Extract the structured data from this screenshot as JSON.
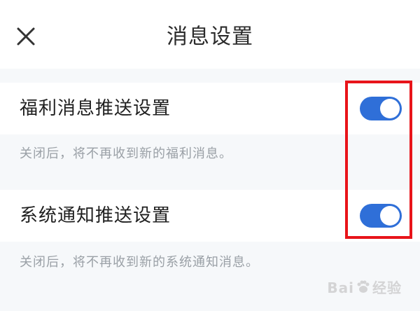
{
  "header": {
    "title": "消息设置",
    "close_icon": "close-icon"
  },
  "settings": [
    {
      "label": "福利消息推送设置",
      "enabled": true,
      "description": "关闭后，将不再收到新的福利消息。"
    },
    {
      "label": "系统通知推送设置",
      "enabled": true,
      "description": "关闭后，将不再收到新的系统通知消息。"
    }
  ],
  "annotation": {
    "color": "#e8141a"
  },
  "watermark": {
    "left_text": "Bai",
    "right_text": "经验"
  },
  "colors": {
    "toggle_on": "#2f6fd8",
    "background": "#f6f8fa"
  }
}
